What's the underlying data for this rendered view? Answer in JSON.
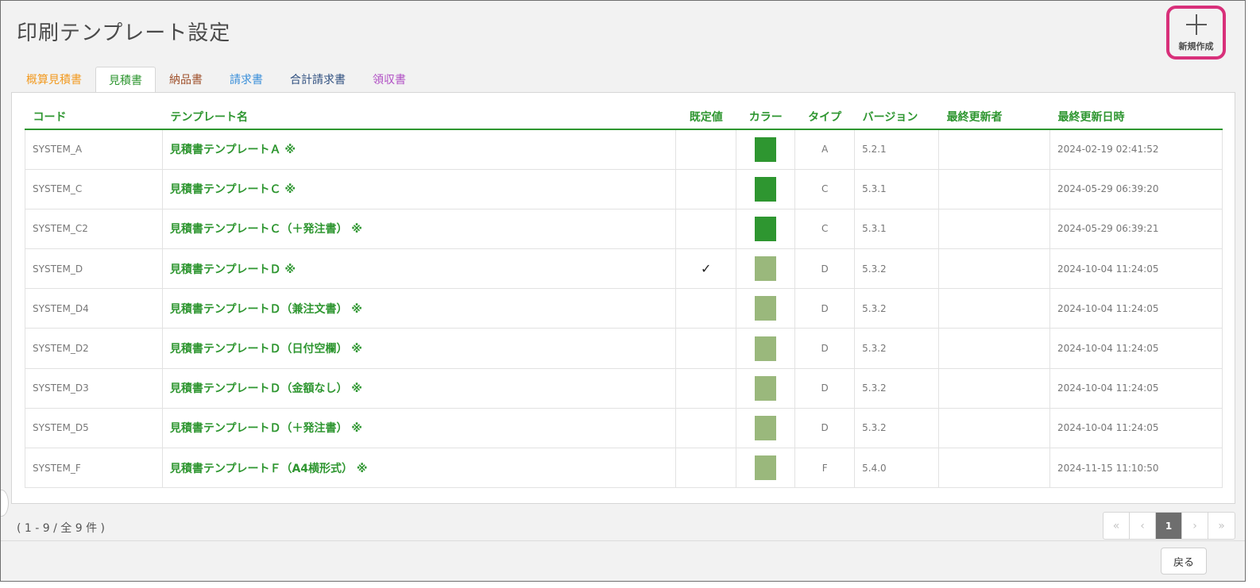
{
  "page": {
    "title": "印刷テンプレート設定"
  },
  "new_button": {
    "label": "新規作成",
    "icon": "plus-icon",
    "highlight_color": "#d8307a"
  },
  "tabs": [
    {
      "label": "概算見積書",
      "color": "#f29b22",
      "active": false
    },
    {
      "label": "見積書",
      "color": "#2e9630",
      "active": true
    },
    {
      "label": "納品書",
      "color": "#a0522d",
      "active": false
    },
    {
      "label": "請求書",
      "color": "#3a8fd9",
      "active": false
    },
    {
      "label": "合計請求書",
      "color": "#2f4f7f",
      "active": false
    },
    {
      "label": "領収書",
      "color": "#b04fc4",
      "active": false
    }
  ],
  "table": {
    "headers": [
      "コード",
      "テンプレート名",
      "既定値",
      "カラー",
      "タイプ",
      "バージョン",
      "最終更新者",
      "最終更新日時"
    ],
    "rows": [
      {
        "code": "SYSTEM_A",
        "name": "見積書テンプレートＡ ※",
        "default": "",
        "color": "#2e9630",
        "type": "A",
        "version": "5.2.1",
        "updater": "",
        "updated": "2024-02-19 02:41:52"
      },
      {
        "code": "SYSTEM_C",
        "name": "見積書テンプレートＣ ※",
        "default": "",
        "color": "#2e9630",
        "type": "C",
        "version": "5.3.1",
        "updater": "",
        "updated": "2024-05-29 06:39:20"
      },
      {
        "code": "SYSTEM_C2",
        "name": "見積書テンプレートＣ（＋発注書） ※",
        "default": "",
        "color": "#2e9630",
        "type": "C",
        "version": "5.3.1",
        "updater": "",
        "updated": "2024-05-29 06:39:21"
      },
      {
        "code": "SYSTEM_D",
        "name": "見積書テンプレートＤ ※",
        "default": "✓",
        "color": "#9ab87c",
        "type": "D",
        "version": "5.3.2",
        "updater": "",
        "updated": "2024-10-04 11:24:05"
      },
      {
        "code": "SYSTEM_D4",
        "name": "見積書テンプレートＤ（兼注文書） ※",
        "default": "",
        "color": "#9ab87c",
        "type": "D",
        "version": "5.3.2",
        "updater": "",
        "updated": "2024-10-04 11:24:05"
      },
      {
        "code": "SYSTEM_D2",
        "name": "見積書テンプレートＤ（日付空欄） ※",
        "default": "",
        "color": "#9ab87c",
        "type": "D",
        "version": "5.3.2",
        "updater": "",
        "updated": "2024-10-04 11:24:05"
      },
      {
        "code": "SYSTEM_D3",
        "name": "見積書テンプレートＤ（金額なし） ※",
        "default": "",
        "color": "#9ab87c",
        "type": "D",
        "version": "5.3.2",
        "updater": "",
        "updated": "2024-10-04 11:24:05"
      },
      {
        "code": "SYSTEM_D5",
        "name": "見積書テンプレートＤ（＋発注書） ※",
        "default": "",
        "color": "#9ab87c",
        "type": "D",
        "version": "5.3.2",
        "updater": "",
        "updated": "2024-10-04 11:24:05"
      },
      {
        "code": "SYSTEM_F",
        "name": "見積書テンプレートＦ（A4横形式） ※",
        "default": "",
        "color": "#9ab87c",
        "type": "F",
        "version": "5.4.0",
        "updater": "",
        "updated": "2024-11-15 11:10:50"
      }
    ]
  },
  "footer": {
    "count_text": "( 1 - 9 / 全 9 件 )",
    "pager": {
      "first": "«",
      "prev": "‹",
      "current": "1",
      "next": "›",
      "last": "»"
    },
    "back_label": "戻る"
  }
}
